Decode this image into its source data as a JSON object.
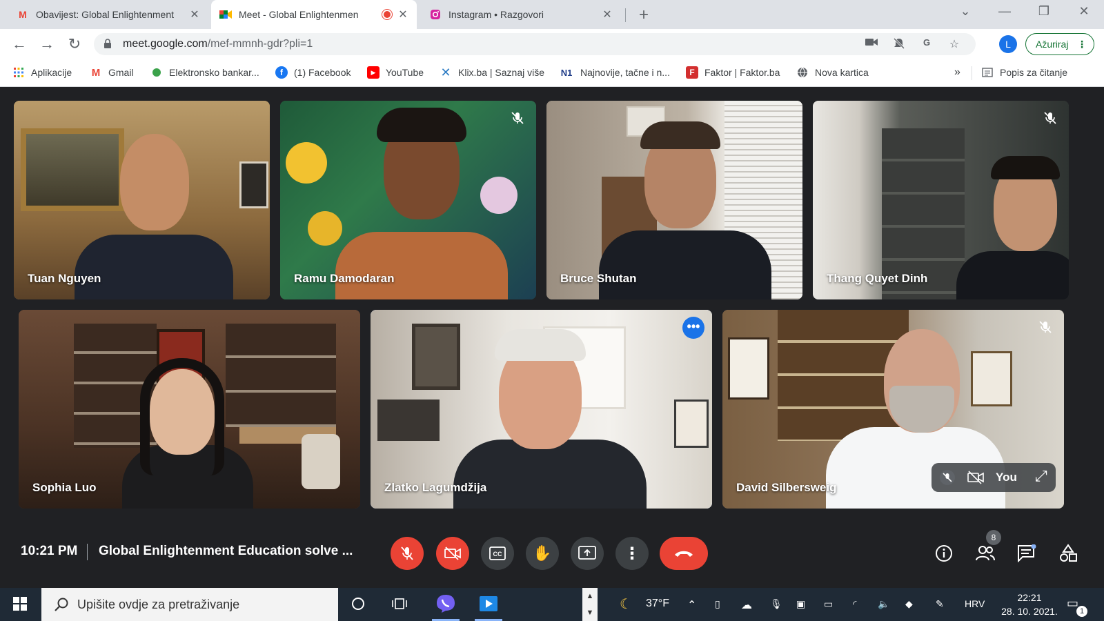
{
  "tabs": [
    {
      "title": "Obavijest: Global Enlightenment",
      "icon": "gmail-icon",
      "active": false
    },
    {
      "title": "Meet - Global Enlightenmen",
      "icon": "meet-icon",
      "active": true,
      "recording": true
    },
    {
      "title": "Instagram • Razgovori",
      "icon": "instagram-icon",
      "active": false
    }
  ],
  "new_tab_label": "+",
  "address_bar": {
    "domain": "meet.google.com",
    "path": "/mef-mmnh-gdr?pli=1"
  },
  "profile_initial": "L",
  "update_button_label": "Ažuriraj",
  "bookmarks": [
    {
      "label": "Aplikacije",
      "icon": "apps-grid-icon"
    },
    {
      "label": "Gmail",
      "icon": "gmail-icon"
    },
    {
      "label": "Elektronsko bankar...",
      "icon": "bank-icon"
    },
    {
      "label": "(1) Facebook",
      "icon": "facebook-icon"
    },
    {
      "label": "YouTube",
      "icon": "youtube-icon"
    },
    {
      "label": "Klix.ba | Saznaj više",
      "icon": "klix-icon"
    },
    {
      "label": "Najnovije, tačne i n...",
      "icon": "n1-icon"
    },
    {
      "label": "Faktor | Faktor.ba",
      "icon": "faktor-icon"
    },
    {
      "label": "Nova kartica",
      "icon": "globe-icon"
    }
  ],
  "bookmarks_overflow": "»",
  "reading_list_label": "Popis za čitanje",
  "participants": [
    {
      "name": "Tuan Nguyen",
      "muted": false
    },
    {
      "name": "Ramu Damodaran",
      "muted": true
    },
    {
      "name": "Bruce Shutan",
      "muted": false
    },
    {
      "name": "Thang Quyet Dinh",
      "muted": true
    },
    {
      "name": "Sophia Luo",
      "muted": false
    },
    {
      "name": "Zlatko Lagumdžija",
      "muted": false,
      "speaking": true
    },
    {
      "name": "David Silbersweig",
      "muted": true
    }
  ],
  "self_view_label": "You",
  "meeting": {
    "time": "10:21 PM",
    "title": "Global Enlightenment Education solve ..."
  },
  "people_count": "8",
  "taskbar": {
    "search_placeholder": "Upišite ovdje za pretraživanje",
    "weather": "37°F",
    "language": "HRV",
    "time": "22:21",
    "date": "28. 10. 2021.",
    "notifications": "1"
  },
  "colors": {
    "speaking_outline": "#8ab4f8",
    "end_call": "#ea4335",
    "meet_bg": "#202124"
  }
}
